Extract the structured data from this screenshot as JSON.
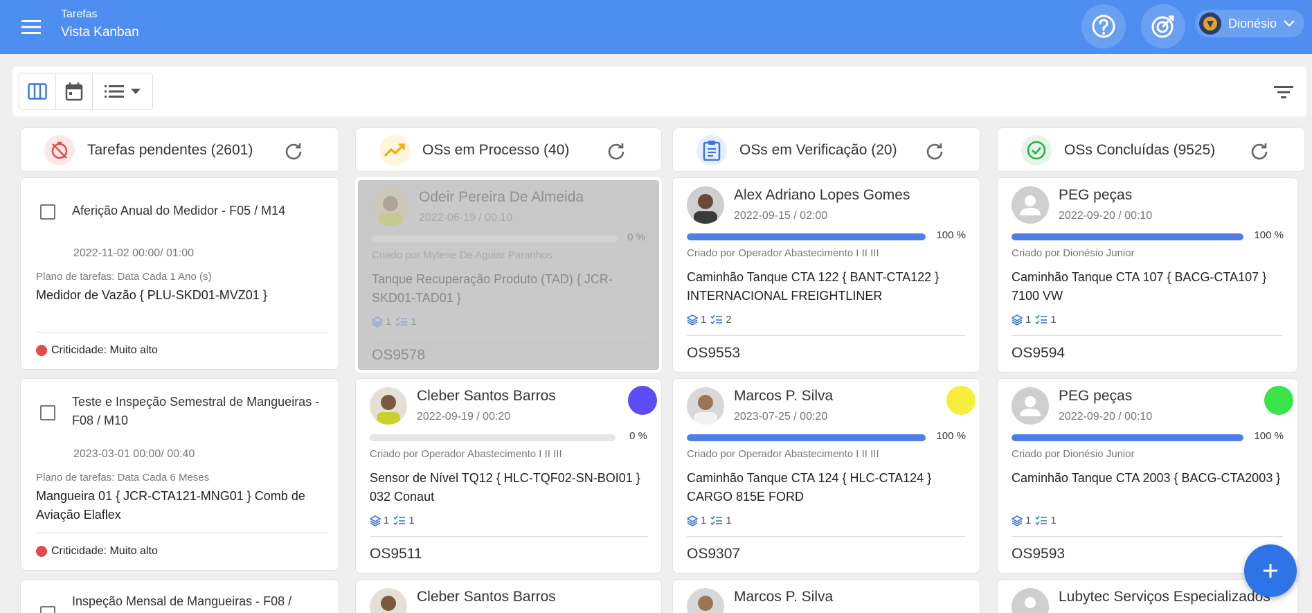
{
  "header": {
    "section": "Tarefas",
    "title": "Vista Kanban",
    "user_name": "Dionésio",
    "icons": [
      "menu-icon",
      "help-icon",
      "target-icon",
      "chevron-down-icon"
    ],
    "accent_color": "#4d8ef0"
  },
  "toolbar": {
    "views": [
      "kanban-view-icon",
      "calendar-icon",
      "list-icon"
    ],
    "filter_icon": "filter-icon"
  },
  "columns": [
    {
      "title": "Tarefas pendentes (2601)",
      "icon": "timer-off-icon",
      "icon_color": "#e64a4a",
      "cards": [
        {
          "title": "Aferição Anual do Medidor - F05 / M14",
          "date": "2022-11-02 00:00/ 01:00",
          "plan": "Plano de tarefas: Data Cada 1 Ano (s)",
          "asset": "Medidor de Vazão { PLU-SKD01-MVZ01 }",
          "criticality": "Criticidade: Muito alto"
        },
        {
          "title": "Teste e Inspeção Semestral de Mangueiras - F08 / M10",
          "date": "2023-03-01 00:00/ 00:40",
          "plan": "Plano de tarefas: Data Cada 6 Meses",
          "asset": "Mangueira 01 { JCR-CTA121-MNG01 } Comb de Aviação Elaflex",
          "criticality": "Criticidade: Muito alto"
        },
        {
          "title": "Inspeção Mensal de Mangueiras - F08 /"
        }
      ]
    },
    {
      "title": "OSs em Processo (40)",
      "icon": "trending-up-icon",
      "icon_color": "#e8b100",
      "cards": [
        {
          "name": "Odeir Pereira De Almeida",
          "date": "2022-06-19 / 00:10",
          "progress": 0,
          "progress_label": "0 %",
          "creator": "Criado por Mylene De Aguiar Paranhos",
          "asset": "Tanque Recuperação Produto (TAD) { JCR-SKD01-TAD01 }",
          "layers": "1",
          "checklist": "1",
          "code": "OS9578",
          "dimmed": true
        },
        {
          "name": "Cleber Santos Barros",
          "date": "2022-09-19 / 00:20",
          "progress": 0,
          "progress_label": "0 %",
          "creator": "Criado por Operador Abastecimento I II III",
          "asset": "Sensor de Nível TQ12 { HLC-TQF02-SN-BOI01 } 032 Conaut",
          "layers": "1",
          "checklist": "1",
          "code": "OS9511",
          "badge_color": "#5b4cf5"
        },
        {
          "name": "Cleber Santos Barros"
        }
      ]
    },
    {
      "title": "OSs em Verificação (20)",
      "icon": "clipboard-icon",
      "icon_color": "#3a78d8",
      "cards": [
        {
          "name": "Alex Adriano Lopes Gomes",
          "date": "2022-09-15 / 02:00",
          "progress": 100,
          "progress_label": "100 %",
          "creator": "Criado por Operador Abastecimento I II III",
          "asset": "Caminhão Tanque CTA 122 { BANT-CTA122 } INTERNACIONAL FREIGHTLINER",
          "layers": "1",
          "checklist": "2",
          "code": "OS9553"
        },
        {
          "name": "Marcos P. Silva",
          "date": "2023-07-25 / 00:20",
          "progress": 100,
          "progress_label": "100 %",
          "creator": "Criado por Operador Abastecimento I II III",
          "asset": "Caminhão Tanque CTA 124 { HLC-CTA124 } CARGO 815E FORD",
          "layers": "1",
          "checklist": "1",
          "code": "OS9307",
          "badge_color": "#f5ee3b"
        },
        {
          "name": "Marcos P. Silva"
        }
      ]
    },
    {
      "title": "OSs Concluídas (9525)",
      "icon": "check-circle-icon",
      "icon_color": "#2eab47",
      "cards": [
        {
          "name": "PEG peças",
          "date": "2022-09-20 / 00:10",
          "progress": 100,
          "progress_label": "100 %",
          "creator": "Criado por Dionésio Junior",
          "asset": "Caminhão Tanque CTA 107 { BACG-CTA107 } 7100 VW",
          "layers": "1",
          "checklist": "1",
          "code": "OS9594"
        },
        {
          "name": "PEG peças",
          "date": "2022-09-20 / 00:10",
          "progress": 100,
          "progress_label": "100 %",
          "creator": "Criado por Dionésio Junior",
          "asset": "Caminhão Tanque CTA 2003 { BACG-CTA2003 }",
          "layers": "1",
          "checklist": "1",
          "code": "OS9593",
          "badge_color": "#3be34a"
        },
        {
          "name": "Lubytec Serviços Especializados"
        }
      ]
    }
  ],
  "fab_icon": "plus-icon"
}
